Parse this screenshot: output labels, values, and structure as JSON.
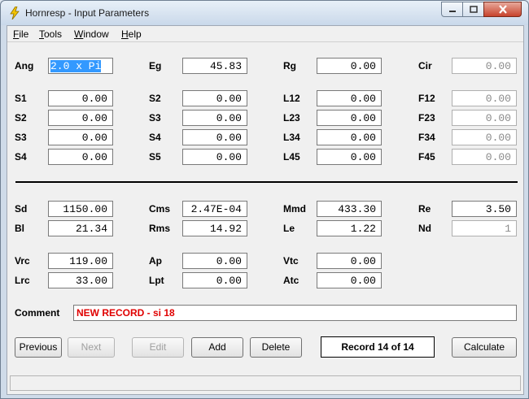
{
  "window": {
    "title": "Hornresp - Input Parameters"
  },
  "menu": [
    "File",
    "Tools",
    "Window",
    "Help"
  ],
  "params": {
    "ang": {
      "label": "Ang",
      "value": "2.0 x Pi"
    },
    "eg": {
      "label": "Eg",
      "value": "45.83"
    },
    "rg": {
      "label": "Rg",
      "value": "0.00"
    },
    "cir": {
      "label": "Cir",
      "value": "0.00"
    },
    "s1": {
      "label": "S1",
      "value": "0.00"
    },
    "s2a": {
      "label": "S2",
      "value": "0.00"
    },
    "s2": {
      "label": "S2",
      "value": "0.00"
    },
    "s3a": {
      "label": "S3",
      "value": "0.00"
    },
    "s3": {
      "label": "S3",
      "value": "0.00"
    },
    "s4a": {
      "label": "S4",
      "value": "0.00"
    },
    "s4": {
      "label": "S4",
      "value": "0.00"
    },
    "s5": {
      "label": "S5",
      "value": "0.00"
    },
    "l12": {
      "label": "L12",
      "value": "0.00"
    },
    "l23": {
      "label": "L23",
      "value": "0.00"
    },
    "l34": {
      "label": "L34",
      "value": "0.00"
    },
    "l45": {
      "label": "L45",
      "value": "0.00"
    },
    "f12": {
      "label": "F12",
      "value": "0.00"
    },
    "f23": {
      "label": "F23",
      "value": "0.00"
    },
    "f34": {
      "label": "F34",
      "value": "0.00"
    },
    "f45": {
      "label": "F45",
      "value": "0.00"
    },
    "sd": {
      "label": "Sd",
      "value": "1150.00"
    },
    "bl": {
      "label": "Bl",
      "value": "21.34"
    },
    "cms": {
      "label": "Cms",
      "value": "2.47E-04"
    },
    "rms": {
      "label": "Rms",
      "value": "14.92"
    },
    "mmd": {
      "label": "Mmd",
      "value": "433.30"
    },
    "le": {
      "label": "Le",
      "value": "1.22"
    },
    "re": {
      "label": "Re",
      "value": "3.50"
    },
    "nd": {
      "label": "Nd",
      "value": "1"
    },
    "vrc": {
      "label": "Vrc",
      "value": "119.00"
    },
    "lrc": {
      "label": "Lrc",
      "value": "33.00"
    },
    "ap": {
      "label": "Ap",
      "value": "0.00"
    },
    "lpt": {
      "label": "Lpt",
      "value": "0.00"
    },
    "vtc": {
      "label": "Vtc",
      "value": "0.00"
    },
    "atc": {
      "label": "Atc",
      "value": "0.00"
    }
  },
  "comment": {
    "label": "Comment",
    "value": "NEW RECORD - si 18"
  },
  "buttons": {
    "previous": "Previous",
    "next": "Next",
    "edit": "Edit",
    "add": "Add",
    "delete": "Delete",
    "calculate": "Calculate"
  },
  "record": "Record 14 of 14",
  "colors": {
    "comment_text": "#e00000",
    "selection": "#3399ff",
    "close_button": "#c7432c"
  },
  "icons": {
    "app": "lightning-icon",
    "minimize": "minimize-icon",
    "maximize": "maximize-icon",
    "close": "close-icon"
  }
}
